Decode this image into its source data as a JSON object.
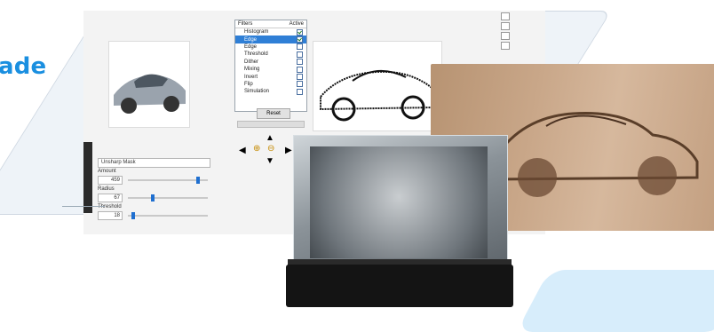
{
  "brand": {
    "text": "ade",
    "color": "#1a8fe0"
  },
  "filters": {
    "header_left": "Filters",
    "header_right": "Active",
    "items": [
      {
        "label": "Histogram",
        "active": true
      },
      {
        "label": "Edge",
        "active": true,
        "selected": true
      },
      {
        "label": "Edge",
        "active": false
      },
      {
        "label": "Threshold",
        "active": false
      },
      {
        "label": "Dither",
        "active": false
      },
      {
        "label": "Mixing",
        "active": false
      },
      {
        "label": "Invert",
        "active": false
      },
      {
        "label": "Flip",
        "active": false
      },
      {
        "label": "Simulation",
        "active": false
      }
    ]
  },
  "reset_label": "Reset",
  "nav_icons": [
    "up-arrow-icon",
    "left-arrow-icon",
    "zoom-in-icon",
    "zoom-out-icon",
    "right-arrow-icon",
    "down-arrow-icon"
  ],
  "controls": {
    "filter_select": "Unsharp Mask",
    "amount_label": "Amount",
    "amount_value": "459",
    "amount_level": 0.9,
    "radius_label": "Radius",
    "radius_value": "67",
    "radius_level": 0.3,
    "threshold_label": "Threshold",
    "threshold_value": "18",
    "threshold_level": 0.05
  },
  "colors": {
    "accent": "#1a8fe0",
    "selection": "#2f7fd6",
    "pill": "#d7edfb"
  }
}
